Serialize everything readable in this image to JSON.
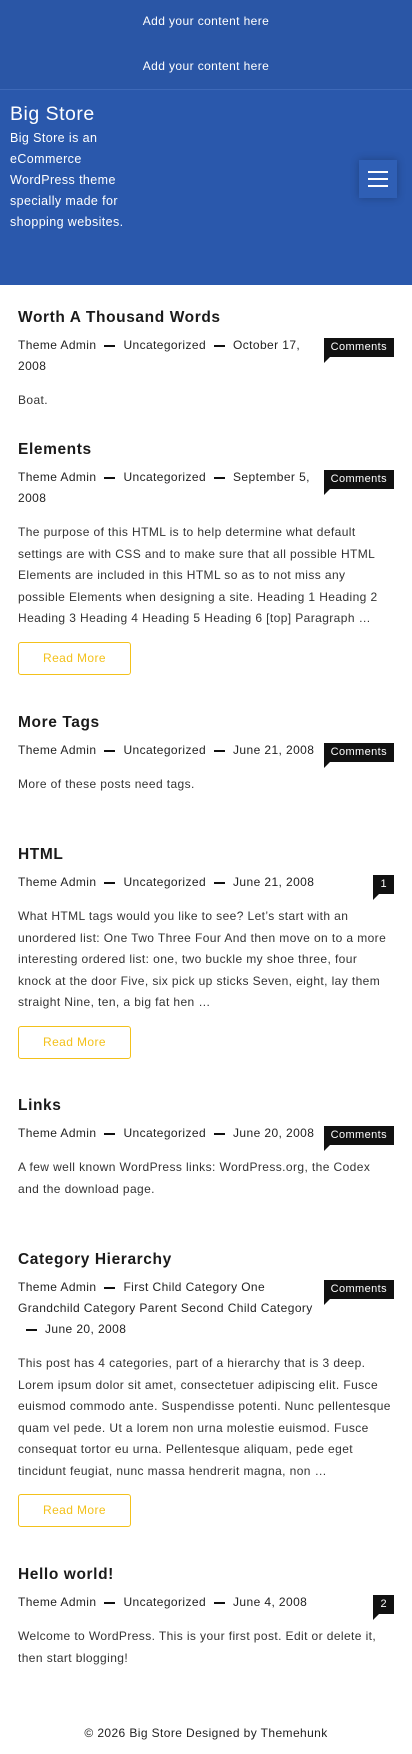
{
  "topbar": {
    "line1": "Add your content here",
    "line2": "Add your content here"
  },
  "header": {
    "site_title": "Big Store",
    "site_description": "Big Store is an eCommerce WordPress theme specially made for shopping websites.",
    "menu_icon": "hamburger-menu-icon"
  },
  "posts": [
    {
      "title": "Worth A Thousand Words",
      "author": "Theme Admin",
      "category": "Uncategorized",
      "date": "October 17, 2008",
      "comments": "Comments",
      "excerpt": "Boat."
    },
    {
      "title": "Elements",
      "author": "Theme Admin",
      "category": "Uncategorized",
      "date": "September 5, 2008",
      "comments": "Comments",
      "excerpt": "The purpose of this HTML is to help determine what default settings are with CSS and to make sure that all possible HTML Elements are included in this HTML so as to not miss any possible Elements when designing a site. Heading 1 Heading 2 Heading 3 Heading 4 Heading 5 Heading 6 [top] Paragraph …",
      "read_more": "Read More"
    },
    {
      "title": "More Tags",
      "author": "Theme Admin",
      "category": "Uncategorized",
      "date": "June 21, 2008",
      "comments": "Comments",
      "excerpt": "More of these posts need tags."
    },
    {
      "title": "HTML",
      "author": "Theme Admin",
      "category": "Uncategorized",
      "date": "June 21, 2008",
      "comments": "1",
      "excerpt": "What HTML tags would you like to see? Let’s start with an unordered list: One Two Three Four And then move on to a more interesting ordered list: one, two buckle my shoe three, four knock at the door Five, six pick up sticks Seven, eight, lay them straight Nine, ten, a big fat hen …",
      "read_more": "Read More"
    },
    {
      "title": "Links",
      "author": "Theme Admin",
      "category": "Uncategorized",
      "date": "June 20, 2008",
      "comments": "Comments",
      "excerpt": "A few well known WordPress links: WordPress.org, the Codex and the download page."
    },
    {
      "title": "Category Hierarchy",
      "author": "Theme Admin",
      "category": "First Child Category One Grandchild Category Parent Second Child Category",
      "date": "June 20, 2008",
      "comments": "Comments",
      "excerpt": "This post has 4 categories, part of a hierarchy that is 3 deep. Lorem ipsum dolor sit amet, consectetuer adipiscing elit. Fusce euismod commodo ante. Suspendisse potenti. Nunc pellentesque quam vel pede. Ut a lorem non urna molestie euismod. Fusce consequat tortor eu urna. Pellentesque aliquam, pede eget tincidunt feugiat, nunc massa hendrerit magna, non …",
      "read_more": "Read More"
    },
    {
      "title": "Hello world!",
      "author": "Theme Admin",
      "category": "Uncategorized",
      "date": "June 4, 2008",
      "comments": "2",
      "excerpt": "Welcome to WordPress. This is your first post. Edit or delete it, then start blogging!"
    }
  ],
  "footer": {
    "text": "© 2026 Big Store Designed by Themehunk"
  }
}
